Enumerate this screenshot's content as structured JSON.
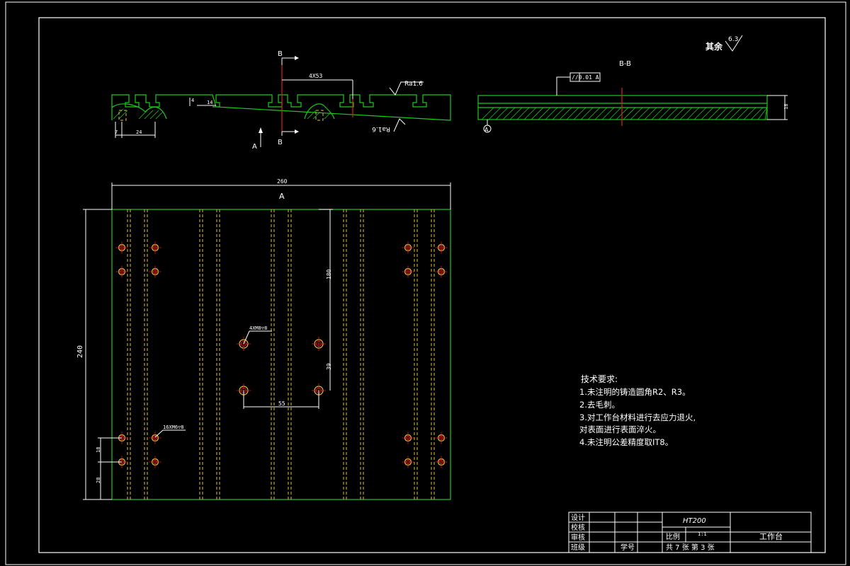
{
  "roughness": {
    "other_label": "其余",
    "other_value": "6.3",
    "top_value": "Ra1.6",
    "bottom_value": "Ra1.6"
  },
  "section": {
    "marker": "B",
    "title": "B-B",
    "datum": "A",
    "view_arrow": "A"
  },
  "dimensions": {
    "tslot_spacing": "4X53",
    "t_slot_depth": "4",
    "t_slot_width": "14",
    "offset_left": "7",
    "first_slot": "24",
    "thickness": "18",
    "overall_width": "260",
    "overall_height": "240",
    "hole_v_spacing": "180",
    "hole_small_v": "39",
    "hole_h_spacing": "55",
    "edge_v_spacing": "18",
    "edge_bottom": "28"
  },
  "callouts": {
    "flatness": "//0.01 A",
    "center_holes": "4XM8▽8",
    "side_holes": "16XM6▽8"
  },
  "tech_requirements": {
    "title": "技术要求:",
    "items": [
      "1.未注明的铸造圆角R2、R3。",
      "2.去毛刺。",
      "3.对工作台材料进行去应力退火,",
      "对表面进行表面淬火。",
      "4.未注明公差精度取IT8。"
    ]
  },
  "title_block": {
    "material": "HT200",
    "scale_label": "比例",
    "scale_value": "1:1",
    "part_name": "工作台",
    "sheet_info": "共 7 张 第 3 张",
    "rows": [
      "设计",
      "校核",
      "审核",
      "班级"
    ],
    "student_id_label": "学号"
  }
}
